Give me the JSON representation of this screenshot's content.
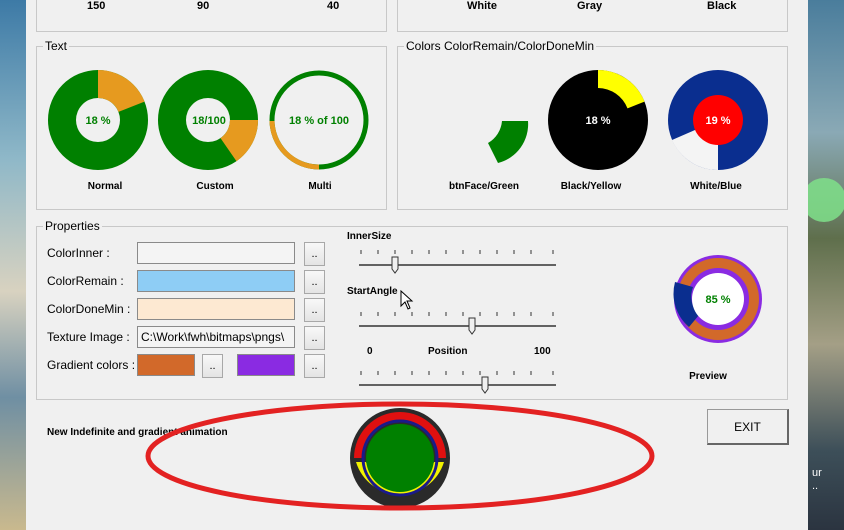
{
  "top_values_left": [
    "150",
    "90",
    "40"
  ],
  "top_values_right": [
    "White",
    "Gray",
    "Black"
  ],
  "text_group": {
    "title": "Text",
    "meters": [
      {
        "label": "Normal",
        "center_text": "18 %",
        "done_fraction": 0.18
      },
      {
        "label": "Custom",
        "center_text": "18/100",
        "done_fraction": 0.18
      },
      {
        "label": "Multi",
        "center_text": "18 % of 100",
        "done_fraction": 0.18
      }
    ]
  },
  "colors_group": {
    "title": "Colors ColorRemain/ColorDoneMin",
    "meters": [
      {
        "label": "btnFace/Green",
        "center_text": ""
      },
      {
        "label": "Black/Yellow",
        "center_text": "18 %"
      },
      {
        "label": "White/Blue",
        "center_text": "19 %"
      }
    ]
  },
  "properties": {
    "title": "Properties",
    "color_inner_label": "ColorInner :",
    "color_remain_label": "ColorRemain :",
    "color_done_min_label": "ColorDoneMin :",
    "texture_label": "Texture Image :",
    "texture_value": "C:\\Work\\fwh\\bitmaps\\pngs\\",
    "gradient_label": "Gradient colors :",
    "browse": "..",
    "inner_size_label": "InnerSize",
    "start_angle_label": "StartAngle",
    "pos_min": "0",
    "pos_label": "Position",
    "pos_max": "100",
    "preview_text": "85 %",
    "preview_label": "Preview"
  },
  "footer": {
    "animation_label": "New Indefinite and gradient animation",
    "exit_label": "EXIT"
  },
  "desktop_text": "ur\n..",
  "colors": {
    "green": "#008000",
    "orange": "#e69a1f",
    "color_remain": "#8ecdf5",
    "color_done_min": "#fde9d2",
    "gradient_1": "#d2692a",
    "gradient_2": "#8a2be2",
    "highlight_ellipse": "#e32222"
  }
}
